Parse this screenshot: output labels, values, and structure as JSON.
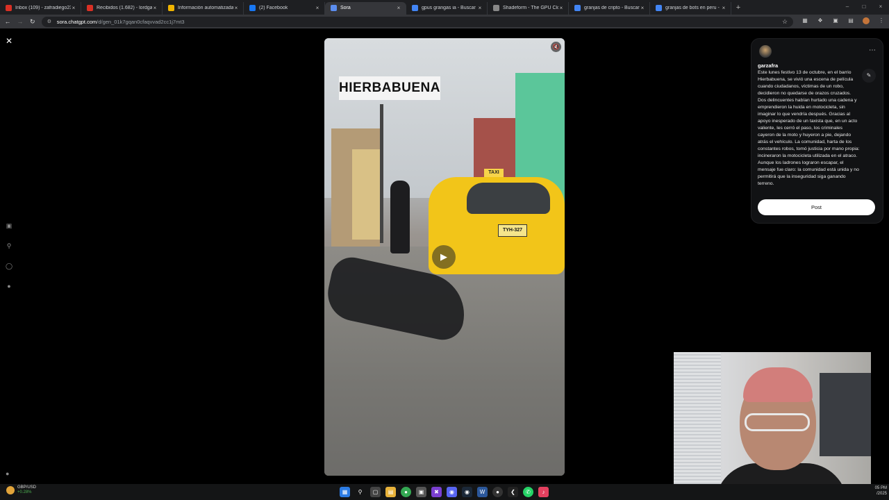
{
  "browser": {
    "tabs": [
      {
        "label": "Inbox (109) - zafradiego23@gm",
        "icon": "gmail-icon",
        "color": "#d93025"
      },
      {
        "label": "Recibidos (1.682) - lordgarzafra",
        "icon": "gmail-icon",
        "color": "#d93025"
      },
      {
        "label": "Información automatizada de",
        "icon": "generic-site-icon",
        "color": "#f0b400"
      },
      {
        "label": "(2) Facebook",
        "icon": "facebook-icon",
        "color": "#1877f2"
      },
      {
        "label": "Sora",
        "icon": "sora-icon",
        "color": "#5b8def",
        "active": true
      },
      {
        "label": "gpus grangas ia - Buscar con G",
        "icon": "google-icon",
        "color": "#4285f4"
      },
      {
        "label": "Shadeform - The GPU Cloud M",
        "icon": "shadeform-icon",
        "color": "#888888"
      },
      {
        "label": "granjas de cripto - Buscar con G",
        "icon": "google-icon",
        "color": "#4285f4"
      },
      {
        "label": "granjas de bots en peru - Busca",
        "icon": "google-icon",
        "color": "#4285f4"
      }
    ],
    "url_host": "sora.chatgpt.com",
    "url_path": "/d/gen_01k7gqan0cfaqvvad2cc1j7mt3"
  },
  "video": {
    "overlay_title": "HIERBABUENA",
    "taxi_sign": "TAXI",
    "plate": "TYH-327"
  },
  "post_panel": {
    "username": "garzafra",
    "caption": "Este lunes festivo 13 de octubre, en el barrio Hierbabuena, se vivió una escena de película cuando ciudadanos, víctimas de un robo, decidieron no quedarse de orazos cruzados. Dos delincuentes habían hurtado una cadena y emprendieron la huida en motocicleta, sin imaginar lo que vendría después. Gracias al apoyo inesperado de un taxista que, en un acto valiente, les cerró el paso, los criminales cayeron de la moto y huyeron a pie, dejando atrás el vehículo. La comunidad, harta de los constantes robos, tomó justicia por mano propia: incineraron la motocicleta utilizada en el atraco. Aunque los ladrones lograron escapar, el mensaje fue claro: la comunidad está unida y no permitirá que la inseguridad siga ganando terreno.",
    "post_button": "Post"
  },
  "taskbar": {
    "ticker_symbol": "GBP/USD",
    "ticker_change": "+0.28%",
    "clock_time": "05 PM",
    "clock_date": "/2025"
  }
}
